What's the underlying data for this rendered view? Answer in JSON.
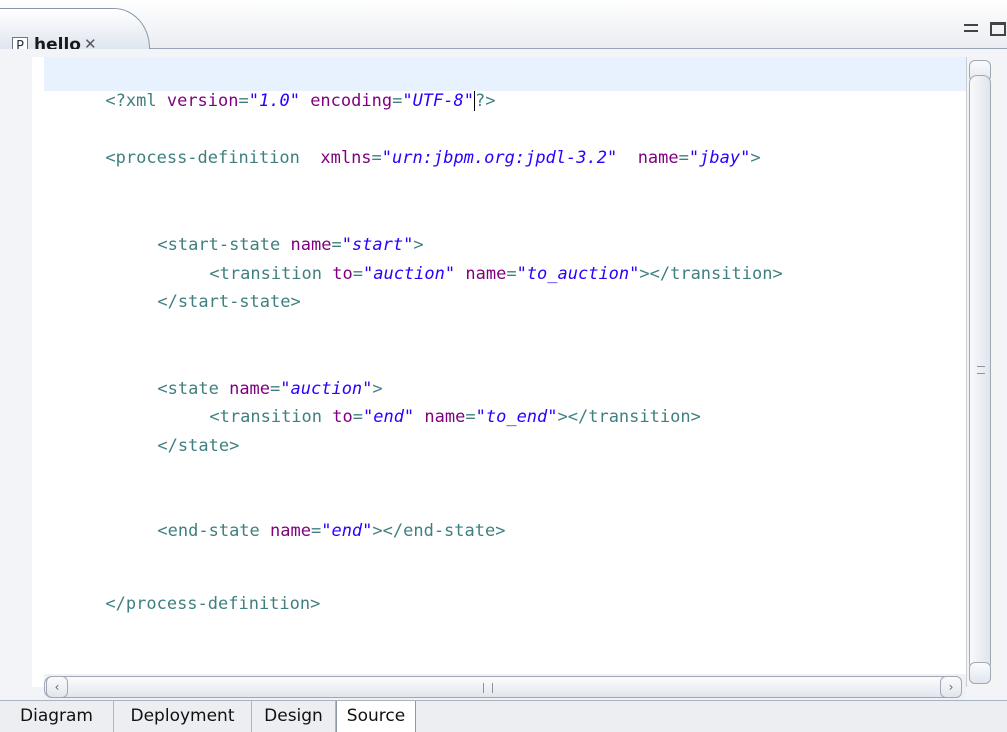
{
  "editor_tab": {
    "label": "hello",
    "icon": "process-file-icon",
    "icon_glyph": "P",
    "close_glyph": "✕"
  },
  "window_controls": {
    "minimize": "minimize-icon",
    "maximize": "maximize-icon"
  },
  "code": {
    "l1": {
      "a": "<?xml ",
      "b": "version",
      "c": "=",
      "d": "\"1.0\"",
      "e": " ",
      "f": "encoding",
      "g": "=",
      "h": "\"UTF-8\"",
      "i": "?>"
    },
    "l2": {
      "a": "<process-definition  ",
      "b": "xmlns",
      "c": "=",
      "d": "\"urn:jbpm.org:jpdl-3.2\"",
      "e": "  ",
      "f": "name",
      "g": "=",
      "h": "\"jbay\"",
      "i": ">"
    },
    "l3": {
      "a": "<start-state ",
      "b": "name",
      "c": "=",
      "d": "\"start\"",
      "e": ">"
    },
    "l4": {
      "a": "<transition ",
      "b": "to",
      "c": "=",
      "d": "\"auction\"",
      "e": " ",
      "f": "name",
      "g": "=",
      "h": "\"to_auction\"",
      "i": "></transition>"
    },
    "l5": {
      "a": "</start-state>"
    },
    "l6": {
      "a": "<state ",
      "b": "name",
      "c": "=",
      "d": "\"auction\"",
      "e": ">"
    },
    "l7": {
      "a": "<transition ",
      "b": "to",
      "c": "=",
      "d": "\"end\"",
      "e": " ",
      "f": "name",
      "g": "=",
      "h": "\"to_end\"",
      "i": "></transition>"
    },
    "l8": {
      "a": "</state>"
    },
    "l9": {
      "a": "<end-state ",
      "b": "name",
      "c": "=",
      "d": "\"end\"",
      "e": "></end-state>"
    },
    "l10": {
      "a": "</process-definition>"
    }
  },
  "page_tabs": {
    "diagram": "Diagram",
    "deployment": "Deployment",
    "design": "Design",
    "source": "Source",
    "active": "Source"
  },
  "colors": {
    "tag": "#3f7f7f",
    "attribute": "#7f007f",
    "value": "#2a00ff",
    "current_line": "#e8f2fe"
  }
}
